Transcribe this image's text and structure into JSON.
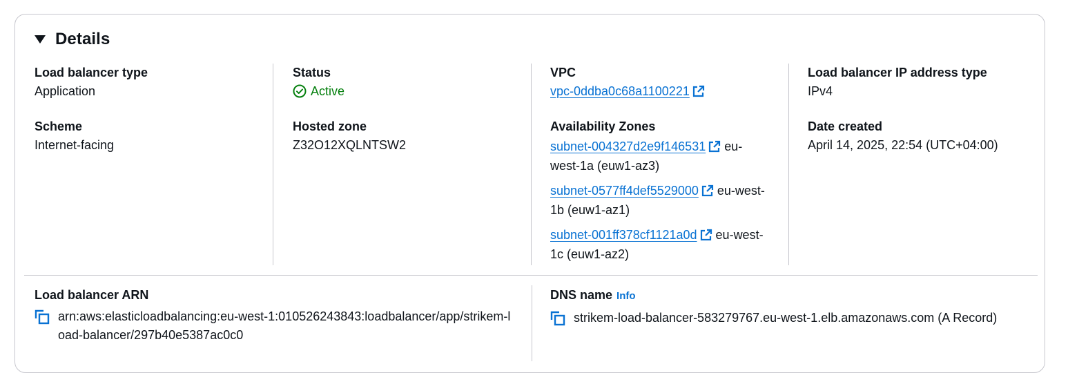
{
  "section": {
    "title": "Details"
  },
  "load_balancer_type": {
    "label": "Load balancer type",
    "value": "Application"
  },
  "scheme": {
    "label": "Scheme",
    "value": "Internet-facing"
  },
  "status": {
    "label": "Status",
    "value": "Active",
    "icon": "check-circle-icon",
    "color": "#037f0c"
  },
  "hosted_zone": {
    "label": "Hosted zone",
    "value": "Z32O12XQLNTSW2"
  },
  "vpc": {
    "label": "VPC",
    "link": "vpc-0ddba0c68a1100221",
    "icon": "external-link-icon"
  },
  "availability_zones": {
    "label": "Availability Zones",
    "items": [
      {
        "subnet": "subnet-004327d2e9f146531",
        "zone": "eu-west-1a (euw1-az3)"
      },
      {
        "subnet": "subnet-0577ff4def5529000",
        "zone": "eu-west-1b (euw1-az1)"
      },
      {
        "subnet": "subnet-001ff378cf1121a0d",
        "zone": "eu-west-1c (euw1-az2)"
      }
    ]
  },
  "ip_address_type": {
    "label": "Load balancer IP address type",
    "value": "IPv4"
  },
  "date_created": {
    "label": "Date created",
    "value": "April 14, 2025, 22:54 (UTC+04:00)"
  },
  "arn": {
    "label": "Load balancer ARN",
    "value": "arn:aws:elasticloadbalancing:eu-west-1:010526243843:loadbalancer/app/strikem-load-balancer/297b40e5387ac0c0",
    "icon": "copy-icon"
  },
  "dns_name": {
    "label": "DNS name",
    "info": "Info",
    "value": "strikem-load-balancer-583279767.eu-west-1.elb.amazonaws.com (A Record)",
    "icon": "copy-icon"
  },
  "colors": {
    "link": "#0972d3",
    "success": "#037f0c",
    "border": "#c6c6cd",
    "text": "#0f141a"
  }
}
